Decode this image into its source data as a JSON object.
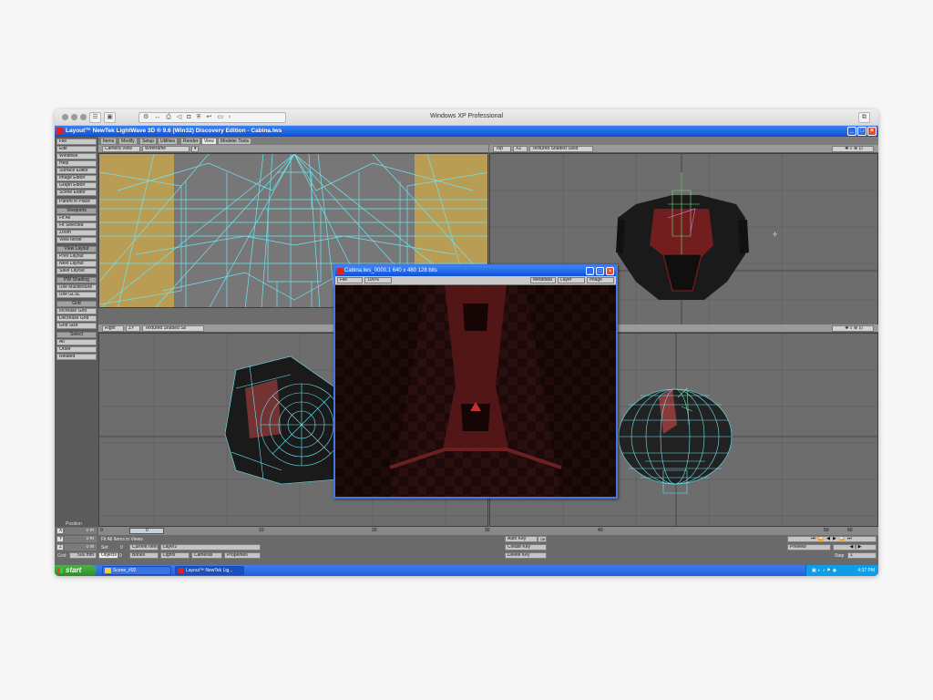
{
  "host": {
    "title": "Windows XP Professional",
    "icons": [
      "wrench-icon",
      "arrows-icon",
      "printer-icon",
      "speaker-icon",
      "camera-icon",
      "shield-icon",
      "back-icon",
      "folder-icon",
      "chevron-left-icon"
    ]
  },
  "window": {
    "title": "Layout™ NewTek LightWave 3D ® 9.6  (Win32) Discovery Edition - Cabina.lws"
  },
  "tabs": [
    "Items",
    "Modify",
    "Setup",
    "Utilities",
    "Render",
    "View",
    "Modeler Tools"
  ],
  "active_tab": "View",
  "sidebar": {
    "menu": [
      "File",
      "Edit",
      "Windows",
      "Help",
      "Surface Editor",
      "Image Editor",
      "Graph Editor",
      "Scene Editor"
    ],
    "parent_in_place": "Parent in Place",
    "viewports_header": "Viewports",
    "viewports": [
      "Fit All",
      "Fit Selected",
      "Zoom",
      "View Mode"
    ],
    "view_layout_header": "View Layout",
    "view_layout": [
      "Prev Layout",
      "Next Layout",
      "Save Layout"
    ],
    "pixel_shading_header": "PW Shading",
    "pixel_shading": [
      "Use Multitexture",
      "Use GLSL"
    ],
    "grid_header": "Grid",
    "grid": [
      "Increase Grid",
      "Decrease Grid",
      "Grid Size"
    ],
    "select_header": "Select",
    "select": [
      "All",
      "Order",
      "Related"
    ]
  },
  "viewports": {
    "top_left": {
      "view": "Camera View",
      "mode": "Wireframe"
    },
    "top_right": {
      "view": "Top",
      "axes": "XZ",
      "mode": "Textured Shaded Solid"
    },
    "bottom_left": {
      "view": "Right",
      "axes": "ZY",
      "mode": "Textured Shaded So"
    }
  },
  "render_window": {
    "title": "Cabina.lws_0000.1  640 x 480 128 bits",
    "file": "File",
    "zoom": "100%",
    "metadata": "Metadata",
    "layer": "Layer",
    "image": "Image"
  },
  "timeline": {
    "position_label": "Position",
    "axes": [
      "X",
      "Y",
      "Z"
    ],
    "axis_values": [
      "0 m",
      "0 m",
      "0 m"
    ],
    "grid_label": "Grid:",
    "grid_value": "500 mm",
    "ticks": [
      "0",
      "10",
      "20",
      "30",
      "40",
      "50",
      "60"
    ],
    "current_frame": "0",
    "status": "Fit All Items in Views",
    "sel_label": "Sel:",
    "sel_value": "0",
    "current_item_label": "Current Item",
    "current_item": "Layer2",
    "item_types": [
      "Objects",
      "Bones",
      "Lights",
      "Cameras"
    ],
    "objects_count": "0",
    "properties": "Properties",
    "auto_key": "Auto Key",
    "auto_key_value": "Off",
    "create_key": "Create Key",
    "delete_key": "Delete Key",
    "preview": "Preview",
    "step_label": "Step",
    "step_value": "1"
  },
  "taskbar": {
    "start": "start",
    "tasks": [
      "Scene_#02",
      "Layout™ NewTek Lig..."
    ],
    "time": "4:37 PM"
  }
}
